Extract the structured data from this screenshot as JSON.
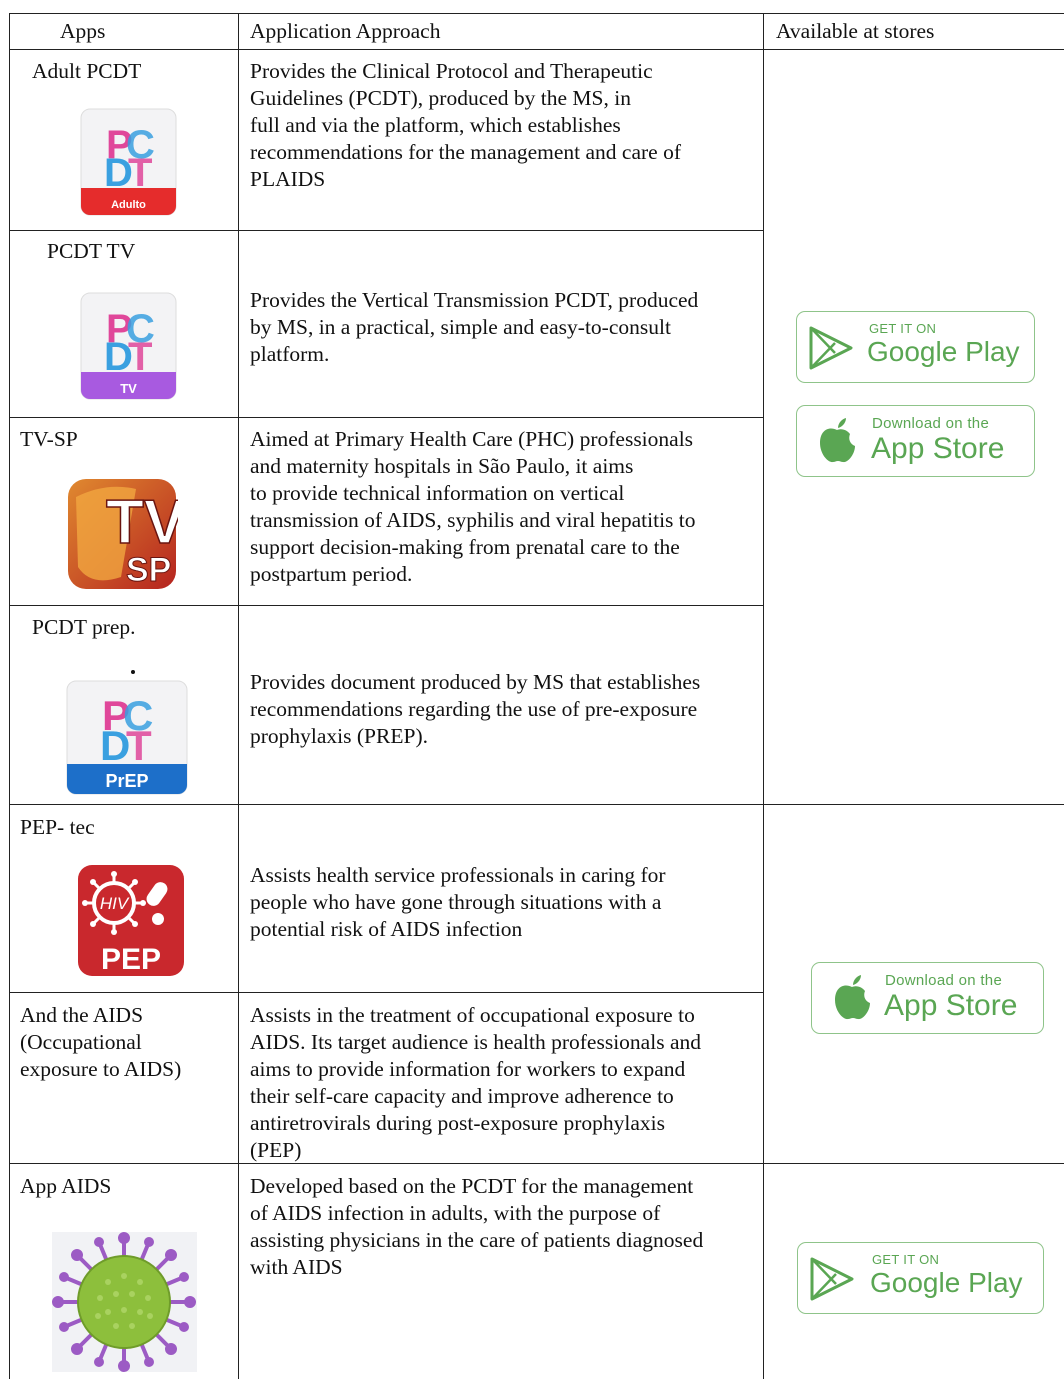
{
  "header": {
    "apps": "Apps",
    "approach": "Application Approach",
    "stores": "Available at stores"
  },
  "rows": [
    {
      "app": "Adult PCDT",
      "icon_label": "Adulto",
      "description": "Provides the Clinical Protocol and Therapeutic\nGuidelines (PCDT), produced by the MS, in\nfull and via the platform, which establishes\nrecommendations for the management and care of\nPLAIDS"
    },
    {
      "app": "PCDT TV",
      "icon_label": "TV",
      "description": "Provides the Vertical Transmission PCDT, produced\nby MS, in a practical, simple and easy-to-consult\nplatform."
    },
    {
      "app": "TV-SP",
      "icon_label": "TV SP",
      "description": "Aimed at Primary Health Care (PHC) professionals\nand maternity hospitals in São Paulo, it aims\nto provide technical information on vertical\ntransmission of AIDS, syphilis and viral hepatitis to\nsupport decision-making from prenatal care to the\npostpartum period."
    },
    {
      "app": "PCDT prep.",
      "icon_label": "PrEP",
      "description": "Provides document produced by MS that establishes\nrecommendations regarding the use of pre-exposure\nprophylaxis (PREP)."
    },
    {
      "app": "PEP- tec",
      "icon_label": "PEP",
      "icon_label2": "HIV",
      "description": "Assists health service professionals in caring for\npeople who have gone through situations with a\npotential risk of AIDS infection"
    },
    {
      "app": "And the AIDS\n(Occupational\nexposure to AIDS)",
      "description": "Assists in the treatment of occupational exposure to\nAIDS. Its target audience is health professionals and\naims to provide information for workers to expand\ntheir self-care capacity and improve adherence to\nantiretrovirals during post-exposure prophylaxis\n(PEP)"
    },
    {
      "app": "App AIDS",
      "description": "Developed based on the PCDT for the management\nof AIDS infection in adults, with the purpose of\nassisting physicians in the care of patients diagnosed\nwith AIDS"
    }
  ],
  "badges": {
    "google_small": "GET IT ON",
    "google_big": "Google Play",
    "apple_small": "Download on the",
    "apple_big": "App Store"
  },
  "colors": {
    "badge_green": "#5aa653",
    "pcdt_pink": "#e0479a",
    "pcdt_blue": "#3aa0e0",
    "adult_red": "#e52c2c",
    "tv_purple": "#a85ae0",
    "prep_blue": "#1d6fc9",
    "pep_red": "#c9282d",
    "virus_green": "#8dbf3c",
    "virus_purple": "#9c5bc4"
  }
}
